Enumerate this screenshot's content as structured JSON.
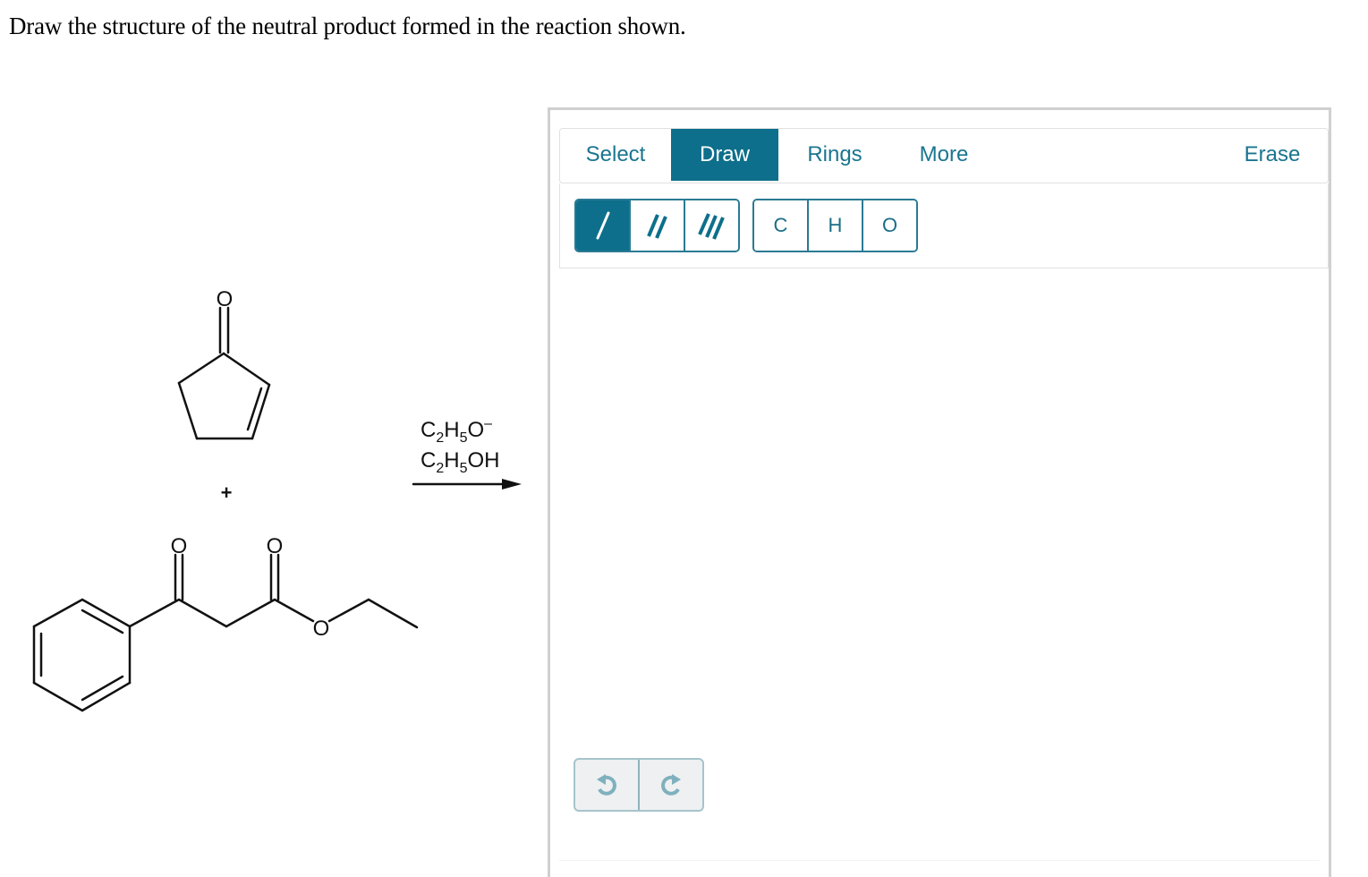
{
  "question": "Draw the structure of the neutral product formed in the reaction shown.",
  "reaction": {
    "reactant1_label": "O",
    "plus": "+",
    "reactant2_labels": [
      "O",
      "O",
      "O"
    ],
    "reagents": {
      "line1": {
        "base": "C",
        "sub1": "2",
        "mid": "H",
        "sub2": "5",
        "tail": "O",
        "sup": "–"
      },
      "line2": {
        "base": "C",
        "sub1": "2",
        "mid": "H",
        "sub2": "5",
        "tail": "OH"
      }
    }
  },
  "editor": {
    "tabs": [
      {
        "label": "Select",
        "active": false
      },
      {
        "label": "Draw",
        "active": true
      },
      {
        "label": "Rings",
        "active": false
      },
      {
        "label": "More",
        "active": false
      }
    ],
    "erase_label": "Erase",
    "bond_tools": [
      {
        "name": "single-bond",
        "icon": "single-bond-icon",
        "active": true
      },
      {
        "name": "double-bond",
        "icon": "double-bond-icon",
        "active": false
      },
      {
        "name": "triple-bond",
        "icon": "triple-bond-icon",
        "active": false
      }
    ],
    "atoms": [
      "C",
      "H",
      "O"
    ],
    "undo_icon": "undo-icon",
    "redo_icon": "redo-icon"
  },
  "colors": {
    "accent": "#0d6f8b",
    "tab_text": "#1a7590",
    "border": "#d0d0d0",
    "undo_icon": "#7fb0bd"
  }
}
